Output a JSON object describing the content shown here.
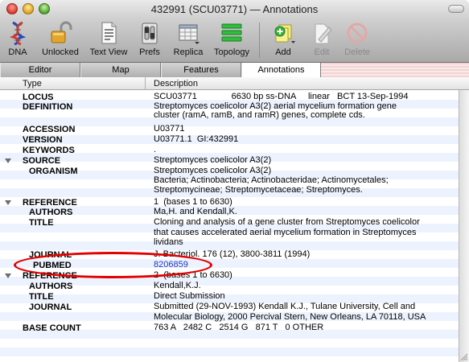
{
  "window": {
    "title": "432991 (SCU03771) — Annotations"
  },
  "toolbar": {
    "dna": "DNA",
    "unlocked": "Unlocked",
    "text_view": "Text View",
    "prefs": "Prefs",
    "replica": "Replica",
    "topology": "Topology",
    "add": "Add",
    "edit": "Edit",
    "delete": "Delete"
  },
  "tabs": [
    "Editor",
    "Map",
    "Features",
    "Annotations"
  ],
  "columns": {
    "type": "Type",
    "description": "Description"
  },
  "rows": {
    "locus": {
      "key": "LOCUS",
      "value": "SCU03771              6630 bp ss-DNA     linear   BCT 13-Sep-1994"
    },
    "definition": {
      "key": "DEFINITION",
      "value1": "Streptomyces coelicolor A3(2) aerial mycelium formation gene",
      "value2": "cluster (ramA, ramB, and ramR) genes, complete cds."
    },
    "accession": {
      "key": "ACCESSION",
      "value": "U03771"
    },
    "version": {
      "key": "VERSION",
      "value": "U03771.1  GI:432991"
    },
    "keywords": {
      "key": "KEYWORDS",
      "value": "."
    },
    "source": {
      "key": "SOURCE",
      "value": "Streptomyces coelicolor A3(2)"
    },
    "organism": {
      "key": "ORGANISM",
      "value1": "Streptomyces coelicolor A3(2)",
      "value2": "Bacteria; Actinobacteria; Actinobacteridae; Actinomycetales;",
      "value3": "Streptomycineae; Streptomycetaceae; Streptomyces."
    },
    "reference1": {
      "key": "REFERENCE",
      "value": "1  (bases 1 to 6630)"
    },
    "authors1": {
      "key": "AUTHORS",
      "value": "Ma,H. and Kendall,K."
    },
    "title1": {
      "key": "TITLE",
      "value1": "Cloning and analysis of a gene cluster from Streptomyces coelicolor",
      "value2": "that causes accelerated aerial mycelium formation in Streptomyces",
      "value3": "lividans"
    },
    "journal1": {
      "key": "JOURNAL",
      "value": "J. Bacteriol. 176 (12), 3800-3811 (1994)"
    },
    "pubmed": {
      "key": "PUBMED",
      "value": "8206859"
    },
    "reference2": {
      "key": "REFERENCE",
      "value": "2  (bases 1 to 6630)"
    },
    "authors2": {
      "key": "AUTHORS",
      "value": "Kendall,K.J."
    },
    "title2": {
      "key": "TITLE",
      "value": "Direct Submission"
    },
    "journal2": {
      "key": "JOURNAL",
      "value1": "Submitted (29-NOV-1993) Kendall K.J., Tulane University, Cell and",
      "value2": "Molecular Biology, 2000 Percival Stern, New Orleans, LA 70118, USA"
    },
    "base_count": {
      "key": "BASE COUNT",
      "value": "763 A   2482 C   2514 G   871 T   0 OTHER"
    }
  },
  "colors": {
    "annotation_oval": "#e30000",
    "link": "#1a33c8",
    "row_stripe": "#edf3fe"
  }
}
